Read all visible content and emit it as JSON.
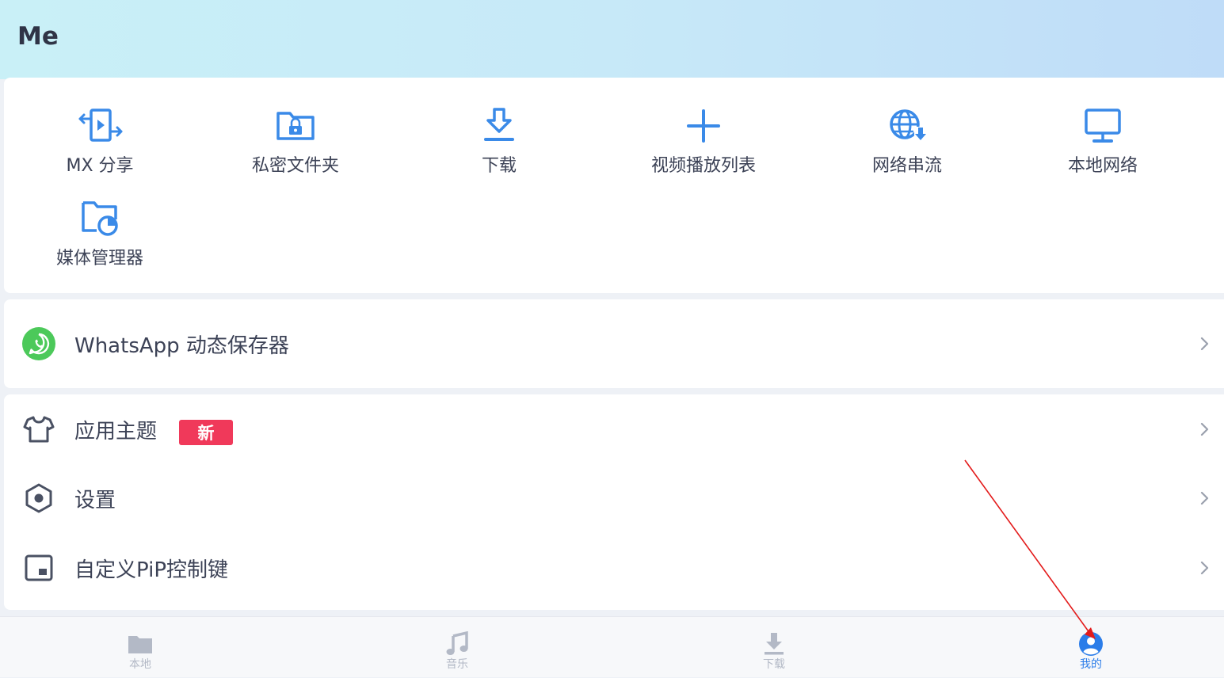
{
  "header": {
    "title": "Me"
  },
  "tools": [
    {
      "label": "MX 分享",
      "icon": "mx-share-icon"
    },
    {
      "label": "私密文件夹",
      "icon": "private-folder-icon"
    },
    {
      "label": "下载",
      "icon": "download-icon"
    },
    {
      "label": "视频播放列表",
      "icon": "plus-icon"
    },
    {
      "label": "网络串流",
      "icon": "network-stream-icon"
    },
    {
      "label": "本地网络",
      "icon": "monitor-icon"
    },
    {
      "label": "媒体管理器",
      "icon": "media-manager-icon"
    }
  ],
  "whatsapp": {
    "label": "WhatsApp 动态保存器",
    "icon": "whatsapp-icon"
  },
  "settings_rows": [
    {
      "label": "应用主题",
      "badge": "新",
      "icon": "tshirt-icon"
    },
    {
      "label": "设置",
      "icon": "settings-hex-icon"
    },
    {
      "label": "自定义PiP控制键",
      "icon": "pip-icon"
    }
  ],
  "bottom_nav": [
    {
      "label": "本地",
      "icon": "folder-icon",
      "active": false
    },
    {
      "label": "音乐",
      "icon": "music-icon",
      "active": false
    },
    {
      "label": "下载",
      "icon": "download-tray-icon",
      "active": false
    },
    {
      "label": "我的",
      "icon": "profile-icon",
      "active": true
    }
  ],
  "colors": {
    "accent": "#2b7de9",
    "icon_blue": "#3a8ae8",
    "badge_red": "#f0395a",
    "whatsapp_green": "#4cc95a",
    "annotation_red": "#e31b1b"
  }
}
